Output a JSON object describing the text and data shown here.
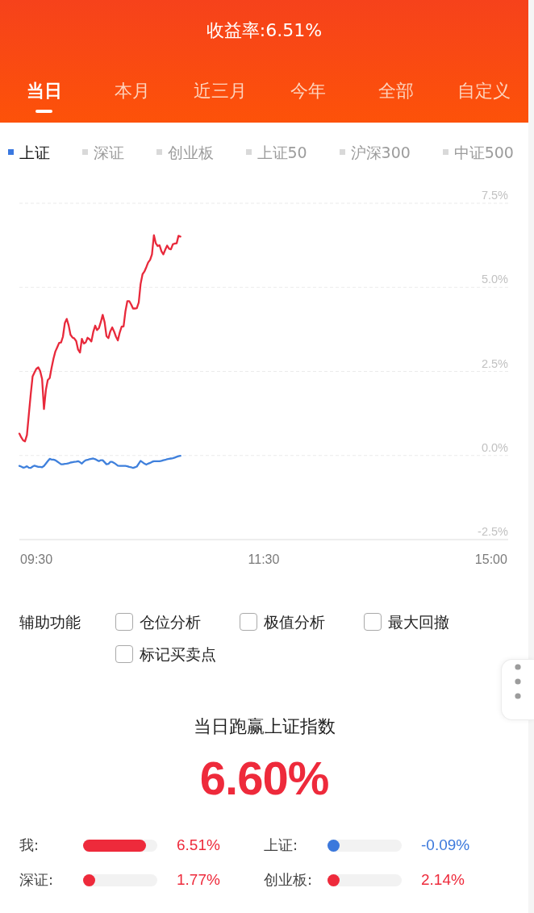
{
  "header": {
    "title": "收益率:6.51%"
  },
  "period_tabs": [
    {
      "label": "当日",
      "selected": true
    },
    {
      "label": "本月",
      "selected": false
    },
    {
      "label": "近三月",
      "selected": false
    },
    {
      "label": "今年",
      "selected": false
    },
    {
      "label": "全部",
      "selected": false
    },
    {
      "label": "自定义",
      "selected": false
    }
  ],
  "index_legend": [
    {
      "label": "上证",
      "selected": true
    },
    {
      "label": "深证",
      "selected": false
    },
    {
      "label": "创业板",
      "selected": false
    },
    {
      "label": "上证50",
      "selected": false
    },
    {
      "label": "沪深300",
      "selected": false
    },
    {
      "label": "中证500",
      "selected": false
    }
  ],
  "chart": {
    "chart_data": {
      "type": "line",
      "grid": true,
      "categories": [
        null,
        null,
        null,
        null,
        null,
        null,
        null,
        null,
        null,
        "09:30",
        null,
        null,
        null,
        null,
        null,
        null,
        null,
        null,
        null,
        null,
        null,
        null,
        null,
        null,
        null,
        null,
        null,
        null,
        null,
        null,
        null,
        null,
        null,
        null,
        null,
        null,
        null,
        null,
        null,
        null,
        null,
        null,
        null,
        null,
        null,
        null,
        null,
        null,
        null,
        null,
        null,
        null,
        null,
        null,
        null,
        null,
        null,
        null,
        null,
        null,
        null,
        null,
        null,
        null,
        null,
        null,
        null,
        null,
        null,
        null,
        null,
        null,
        null,
        null,
        null,
        null,
        null,
        null,
        null,
        null,
        null,
        null,
        null,
        null,
        null,
        null,
        null,
        null,
        null,
        null,
        null,
        null,
        null,
        null,
        null,
        null,
        null,
        null,
        null,
        null,
        null,
        null,
        null,
        null,
        null,
        null,
        null,
        null,
        null,
        null,
        null,
        null,
        null,
        null,
        null,
        null,
        null,
        null,
        null,
        null,
        null,
        null,
        null,
        null,
        null,
        null,
        null,
        null,
        null,
        "11:30",
        null,
        null,
        null,
        null,
        null,
        null,
        null,
        null,
        null,
        null,
        null,
        null,
        null,
        null,
        null,
        null,
        null,
        null,
        null,
        null,
        null,
        null,
        null,
        null,
        null,
        null,
        null,
        null,
        null,
        null,
        null,
        null,
        null,
        null,
        null,
        null,
        null,
        null,
        null,
        null,
        null,
        null,
        null,
        null,
        null,
        null,
        null,
        null,
        null,
        null,
        null,
        null,
        null,
        null,
        null,
        null,
        null,
        null,
        null,
        null,
        null,
        null,
        null,
        null,
        null,
        null,
        null,
        null,
        null,
        null,
        null,
        null,
        null,
        null,
        null,
        null,
        null,
        null,
        null,
        null,
        null,
        null,
        null,
        null,
        null,
        null,
        null,
        null,
        null,
        null,
        null,
        null,
        null,
        null,
        null,
        null,
        null,
        null,
        null,
        null,
        null,
        null,
        null,
        null,
        null,
        null,
        null,
        null,
        null,
        null,
        null,
        null,
        null,
        null,
        null,
        null,
        null,
        null,
        null,
        "15:00",
        null,
        null,
        null,
        null,
        null,
        null,
        null,
        null,
        null
      ],
      "series": [
        {
          "color": "#e8293b",
          "values": [
            0.65,
            0.54,
            0.45,
            0.42,
            0.61,
            1.21,
            1.82,
            2.35,
            2.47,
            2.58,
            2.62,
            2.51,
            2.27,
            1.38,
            1.95,
            2.24,
            2.3,
            2.6,
            2.88,
            3.09,
            3.22,
            3.35,
            3.36,
            3.53,
            3.94,
            4.06,
            3.87,
            3.59,
            3.51,
            3.48,
            3.4,
            3.15,
            3.06,
            3.47,
            3.33,
            3.36,
            3.5,
            3.46,
            3.39,
            3.67,
            3.86,
            3.73,
            3.79,
            3.97,
            4.18,
            3.96,
            3.55,
            3.49,
            3.69,
            3.81,
            3.69,
            3.53,
            3.42,
            3.66,
            3.83,
            3.84,
            4.29,
            4.59,
            4.59,
            4.49,
            4.37,
            4.37,
            4.38,
            4.55,
            5.1,
            5.39,
            5.47,
            5.6,
            5.74,
            5.82,
            5.98,
            6.55,
            6.31,
            6.23,
            6.25,
            6.07,
            5.98,
            6.12,
            6.24,
            6.15,
            6.13,
            6.28,
            6.3,
            6.31,
            6.53,
            6.51,
            null,
            null,
            null,
            null,
            null,
            null,
            null,
            null,
            null,
            null,
            null,
            null,
            null,
            null,
            null,
            null,
            null,
            null,
            null,
            null,
            null,
            null,
            null,
            null,
            null,
            null,
            null,
            null,
            null,
            null,
            null,
            null,
            null,
            null,
            null,
            null,
            null,
            null,
            null,
            null,
            null,
            null,
            null,
            null,
            null,
            null,
            null,
            null,
            null,
            null,
            null,
            null,
            null,
            null,
            null,
            null,
            null,
            null,
            null,
            null,
            null,
            null,
            null,
            null,
            null,
            null,
            null,
            null,
            null,
            null,
            null,
            null,
            null,
            null,
            null,
            null,
            null,
            null,
            null,
            null,
            null,
            null,
            null,
            null,
            null,
            null,
            null,
            null,
            null,
            null,
            null,
            null,
            null,
            null,
            null,
            null,
            null,
            null,
            null,
            null,
            null,
            null,
            null,
            null,
            null,
            null,
            null,
            null,
            null,
            null,
            null,
            null,
            null,
            null,
            null,
            null,
            null,
            null,
            null,
            null,
            null,
            null,
            null,
            null,
            null,
            null,
            null,
            null,
            null,
            null,
            null,
            null,
            null,
            null,
            null,
            null,
            null,
            null,
            null,
            null,
            null,
            null,
            null,
            null,
            null,
            null,
            null,
            null,
            null,
            null,
            null,
            null,
            null,
            null,
            null,
            null,
            null,
            null,
            null,
            null,
            null,
            null,
            null,
            null,
            null,
            null,
            null,
            null,
            null,
            null,
            null,
            null,
            null
          ]
        },
        {
          "color": "#3f80dc",
          "values": [
            -0.31,
            -0.33,
            -0.36,
            -0.35,
            -0.32,
            -0.36,
            -0.37,
            -0.33,
            -0.3,
            -0.32,
            -0.34,
            -0.34,
            -0.35,
            -0.31,
            -0.24,
            -0.17,
            -0.1,
            -0.12,
            -0.12,
            -0.14,
            -0.18,
            -0.22,
            -0.26,
            -0.26,
            -0.25,
            -0.24,
            -0.23,
            -0.21,
            -0.2,
            -0.19,
            -0.18,
            -0.17,
            -0.2,
            -0.24,
            -0.18,
            -0.14,
            -0.13,
            -0.11,
            -0.1,
            -0.09,
            -0.11,
            -0.14,
            -0.17,
            -0.14,
            -0.14,
            -0.2,
            -0.26,
            -0.25,
            -0.19,
            -0.19,
            -0.22,
            -0.26,
            -0.3,
            -0.31,
            -0.31,
            -0.31,
            -0.31,
            -0.32,
            -0.34,
            -0.35,
            -0.37,
            -0.35,
            -0.33,
            -0.24,
            -0.16,
            -0.2,
            -0.24,
            -0.27,
            -0.24,
            -0.22,
            -0.19,
            -0.17,
            -0.17,
            -0.17,
            -0.17,
            -0.16,
            -0.14,
            -0.13,
            -0.11,
            -0.1,
            -0.09,
            -0.08,
            -0.06,
            -0.04,
            -0.02,
            -0.01,
            null,
            null,
            null,
            null,
            null,
            null,
            null,
            null,
            null,
            null,
            null,
            null,
            null,
            null,
            null,
            null,
            null,
            null,
            null,
            null,
            null,
            null,
            null,
            null,
            null,
            null,
            null,
            null,
            null,
            null,
            null,
            null,
            null,
            null,
            null,
            null,
            null,
            null,
            null,
            null,
            null,
            null,
            null,
            null,
            null,
            null,
            null,
            null,
            null,
            null,
            null,
            null,
            null,
            null,
            null,
            null,
            null,
            null,
            null,
            null,
            null,
            null,
            null,
            null,
            null,
            null,
            null,
            null,
            null,
            null,
            null,
            null,
            null,
            null,
            null,
            null,
            null,
            null,
            null,
            null,
            null,
            null,
            null,
            null,
            null,
            null,
            null,
            null,
            null,
            null,
            null,
            null,
            null,
            null,
            null,
            null,
            null,
            null,
            null,
            null,
            null,
            null,
            null,
            null,
            null,
            null,
            null,
            null,
            null,
            null,
            null,
            null,
            null,
            null,
            null,
            null,
            null,
            null,
            null,
            null,
            null,
            null,
            null,
            null,
            null,
            null,
            null,
            null,
            null,
            null,
            null,
            null,
            null,
            null,
            null,
            null,
            null,
            null,
            null,
            null,
            null,
            null,
            null,
            null,
            null,
            null,
            null,
            null,
            null,
            null,
            null,
            null,
            null,
            null,
            null,
            null,
            null,
            null,
            null,
            null,
            null,
            null,
            null,
            null,
            null,
            null,
            null,
            null,
            null,
            null,
            null,
            null,
            null
          ]
        }
      ],
      "ylim": [
        -2.5,
        7.5
      ],
      "yticks": [
        {
          "value": 7.5,
          "label": "7.5%"
        },
        {
          "value": 5,
          "label": "5.0%"
        },
        {
          "value": 2.5,
          "label": "2.5%"
        },
        {
          "value": 0,
          "label": "0.0%"
        },
        {
          "value": -2.5,
          "label": "-2.5%"
        }
      ]
    }
  },
  "assist": {
    "label": "辅助功能",
    "options": [
      {
        "label": "仓位分析",
        "checked": false
      },
      {
        "label": "极值分析",
        "checked": false
      },
      {
        "label": "最大回撤",
        "checked": false
      },
      {
        "label": "标记买卖点",
        "checked": false
      }
    ]
  },
  "summary": {
    "title": "当日跑赢上证指数",
    "value": "6.60%"
  },
  "comparisons": [
    {
      "label": "我:",
      "level": 0.85,
      "value": "6.51%",
      "color": "#ee2a3b"
    },
    {
      "label": "上证:",
      "level": 0.15,
      "value": "-0.09%",
      "color": "#3b78dc"
    },
    {
      "label": "深证:",
      "level": 0.15,
      "value": "1.77%",
      "color": "#ee2a3b"
    },
    {
      "label": "创业板:",
      "level": 0.16,
      "value": "2.14%",
      "color": "#ee2a3b"
    }
  ]
}
